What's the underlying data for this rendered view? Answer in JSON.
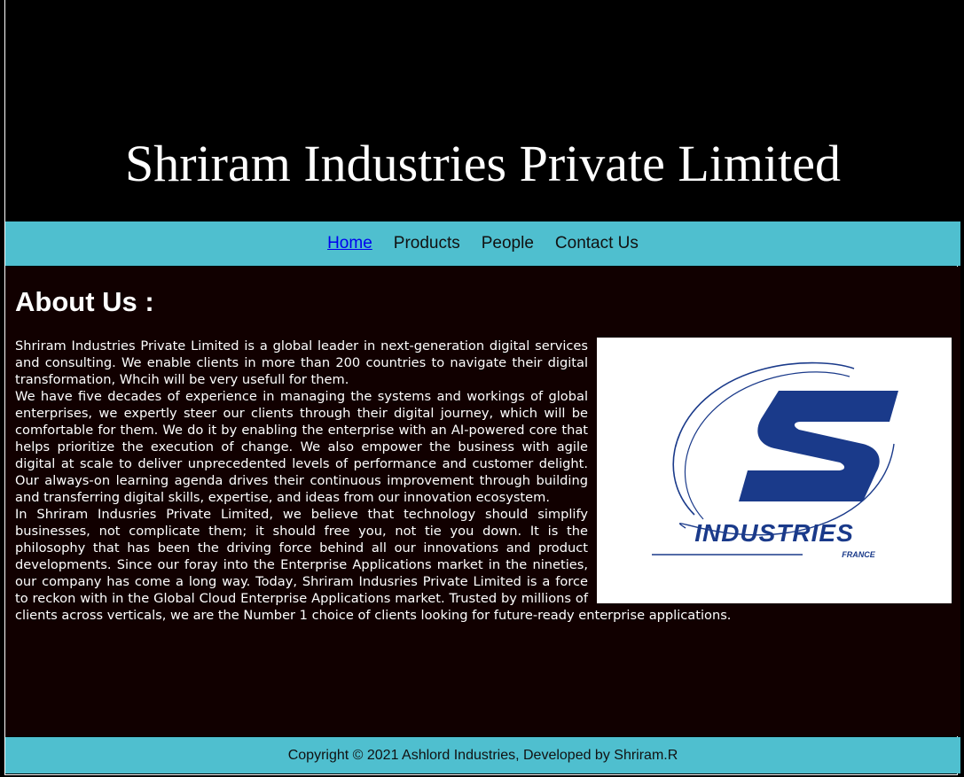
{
  "header": {
    "title": "Shriram Industries Private Limited"
  },
  "nav": {
    "items": [
      {
        "label": "Home",
        "active": true
      },
      {
        "label": "Products",
        "active": false
      },
      {
        "label": "People",
        "active": false
      },
      {
        "label": "Contact Us",
        "active": false
      }
    ]
  },
  "about": {
    "heading": "About Us :",
    "paragraphs": [
      "Shriram Industries Private Limited is a global leader in next-generation digital services and consulting. We enable clients in more than 200 countries to navigate their digital transformation, Whcih will be very usefull for them.",
      "We have five decades of experience in managing the systems and workings of global enterprises, we expertly steer our clients through their digital journey, which will be comfortable for them. We do it by enabling the enterprise with an AI-powered core that helps prioritize the execution of change. We also empower the business with agile digital at scale to deliver unprecedented levels of performance and customer delight. Our always-on learning agenda drives their continuous improvement through building and transferring digital skills, expertise, and ideas from our innovation ecosystem.",
      "In Shriram Indusries Private Limited, we believe that technology should simplify businesses, not complicate them; it should free you, not tie you down. It is the philosophy that has been the driving force behind all our innovations and product developments. Since our foray into the Enterprise Applications market in the nineties, our company has come a long way. Today, Shriram Indusries Private Limited is a force to reckon with in the Global Cloud Enterprise Applications market. Trusted by millions of clients across verticals, we are the Number 1 choice of clients looking for future-ready enterprise applications."
    ],
    "logo": {
      "wordmark": "INDUSTRIES",
      "subtext": "FRANCE",
      "color": "#1a3a8a"
    }
  },
  "footer": {
    "text": "Copyright © 2021 Ashlord Industries, Developed by Shriram.R"
  },
  "colors": {
    "nav_background": "#4fbfcf",
    "content_background": "#110000",
    "link_active": "#0000ee"
  }
}
